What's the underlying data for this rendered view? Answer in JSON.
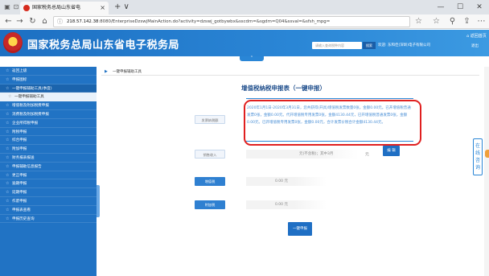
{
  "browser": {
    "tab_title": "国家税务总局山东省电",
    "tab_close": "×",
    "new_tab": "+ ∨",
    "window_controls": [
      "—",
      "☐",
      "✕"
    ],
    "nav_icons": [
      "←",
      "→",
      "↻",
      "⌂"
    ],
    "url_host": "218.57.142.38",
    "url_path": ":8080/EnterpriseDzswjMainAction.do?activity=dzswj_gotbywbx&sscdm=&sgdm=Q04&ssval=&sfsh_mpg=",
    "toolbar_icons": [
      "☆",
      "☆",
      "⚲",
      "⇪",
      "⋯"
    ]
  },
  "header": {
    "site_title": "国家税务总局山东省电子税务局",
    "search_placeholder": "请输入查询税种内容",
    "search_button": "搜索",
    "welcome_text": "欢迎: 东和佳(深圳)电子有限公司",
    "home_link": "⌂ 返回首页",
    "logout": "退出",
    "collapse_arrow": "⌃"
  },
  "sidebar": {
    "items": [
      {
        "label": "返回上级",
        "type": "top"
      },
      {
        "label": "申报图标",
        "type": "top"
      },
      {
        "label": "一键申报辅助工具(季度)",
        "type": "open"
      },
      {
        "label": "一键申报辅助工具",
        "type": "sub"
      },
      {
        "label": "增值税及附加税费申报",
        "type": "top"
      },
      {
        "label": "消费税及附加税费申报",
        "type": "top"
      },
      {
        "label": "企业所得税申报",
        "type": "top"
      },
      {
        "label": "附税申报",
        "type": "top"
      },
      {
        "label": "综合申报",
        "type": "top"
      },
      {
        "label": "附加申报",
        "type": "top"
      },
      {
        "label": "财务报表报送",
        "type": "top"
      },
      {
        "label": "申报辅助信息报告",
        "type": "top"
      },
      {
        "label": "更正申报",
        "type": "top"
      },
      {
        "label": "逾期申报",
        "type": "top"
      },
      {
        "label": "延期申报",
        "type": "top"
      },
      {
        "label": "作废申报",
        "type": "top"
      },
      {
        "label": "申报表查看",
        "type": "top"
      },
      {
        "label": "申报历史查询",
        "type": "top"
      }
    ],
    "star": "☆"
  },
  "main": {
    "breadcrumb": "一键申报辅助工具",
    "form_title": "增值税纳税申报表（一键申报）",
    "declare_label": "发票纳税额",
    "declare_text": "2020年1月1日-2020年3月31日，您共获得(开具)增值税发票数量0张，金额0.00元。已开增值税普通发票0张，金额0.00元。代开增值税专用发票0张，金额4130.44元，已开增值税普通发票0张，金额0.00元。已开增值税专用发票0张，金额0.00元，合计发票价税合计金额4130.44元。",
    "declare_summary": "(2020年1月1日-2020年3月31日，您共获得(开具)增值税发票数量0张，金额0.00元。)",
    "sales_label": "销售收入",
    "sales_value": "元(不含税)；其中3月",
    "sales_unit": "元",
    "edit_button": "编 辑",
    "vat_label": "增值税",
    "vat_value": "0.00 元",
    "surtax_label": "附加税",
    "surtax_value": "0.00 元",
    "submit_button": "一键申报",
    "online_service": "在线咨询"
  }
}
